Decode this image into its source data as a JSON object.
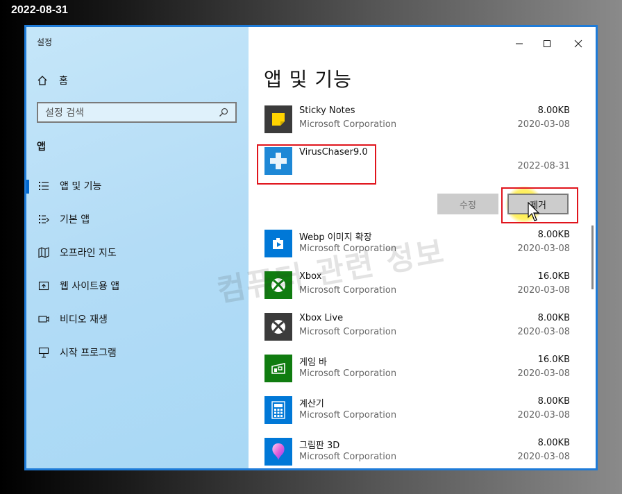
{
  "date_stamp": "2022-08-31",
  "window": {
    "title": "설정",
    "controls": {
      "minimize": "—",
      "maximize": "☐",
      "close": "✕"
    }
  },
  "sidebar": {
    "home_label": "홈",
    "search_placeholder": "설정 검색",
    "section_title": "앱",
    "items": [
      {
        "label": "앱 및 기능",
        "icon": "apps-features-icon",
        "active": true
      },
      {
        "label": "기본 앱",
        "icon": "default-apps-icon",
        "active": false
      },
      {
        "label": "오프라인 지도",
        "icon": "offline-maps-icon",
        "active": false
      },
      {
        "label": "웹 사이트용 앱",
        "icon": "apps-for-websites-icon",
        "active": false
      },
      {
        "label": "비디오 재생",
        "icon": "video-playback-icon",
        "active": false
      },
      {
        "label": "시작 프로그램",
        "icon": "startup-icon",
        "active": false
      }
    ]
  },
  "main": {
    "title": "앱 및 기능",
    "apps": [
      {
        "name": "Sticky Notes",
        "publisher": "Microsoft Corporation",
        "size": "8.00KB",
        "date": "2020-03-08",
        "icon": "sticky-notes-icon"
      },
      {
        "name": "VirusChaser9.0",
        "publisher": "",
        "size": "",
        "date": "2022-08-31",
        "icon": "viruschaser-icon",
        "selected": true
      },
      {
        "name": "Webp 이미지 확장",
        "publisher": "Microsoft Corporation",
        "size": "8.00KB",
        "date": "2020-03-08",
        "icon": "webp-extension-icon"
      },
      {
        "name": "Xbox",
        "publisher": "Microsoft Corporation",
        "size": "16.0KB",
        "date": "2020-03-08",
        "icon": "xbox-icon"
      },
      {
        "name": "Xbox Live",
        "publisher": "Microsoft Corporation",
        "size": "8.00KB",
        "date": "2020-03-08",
        "icon": "xbox-live-icon"
      },
      {
        "name": "게임 바",
        "publisher": "Microsoft Corporation",
        "size": "16.0KB",
        "date": "2020-03-08",
        "icon": "game-bar-icon"
      },
      {
        "name": "계산기",
        "publisher": "Microsoft Corporation",
        "size": "8.00KB",
        "date": "2020-03-08",
        "icon": "calculator-icon"
      },
      {
        "name": "그림판 3D",
        "publisher": "Microsoft Corporation",
        "size": "8.00KB",
        "date": "2020-03-08",
        "icon": "paint-3d-icon"
      }
    ],
    "modify_label": "수정",
    "remove_label": "제거"
  },
  "watermark": "컴퓨터 관련 정보",
  "colors": {
    "accent": "#1e7bd8",
    "highlight": "#e0141c",
    "xbox_green": "#107c10",
    "app_tile_blue": "#0078d7"
  }
}
